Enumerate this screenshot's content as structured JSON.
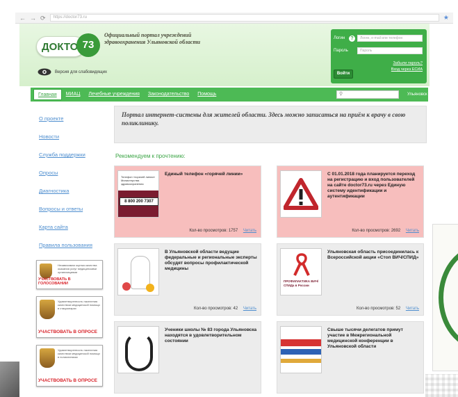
{
  "browser": {
    "back": "←",
    "forward": "→",
    "reload": "⟳",
    "address": "https://doctor73.ru"
  },
  "header": {
    "logo_word": "ДОКТОР",
    "logo_number": "73",
    "portal_title": "Официальный портал учреждений здравоохранения Ульяновской области",
    "low_vision": "Версия для слабовидящих"
  },
  "login": {
    "login_label": "Логин",
    "login_placeholder": "Логин, e-mail или телефон",
    "password_label": "Пароль",
    "password_placeholder": "Пароль",
    "submit": "Войти",
    "forgot": "Забыли пароль?",
    "esia": "Вход через ЕСИА",
    "help": "?"
  },
  "nav": {
    "items": [
      "Главная",
      "МИАЦ",
      "Лечебные учреждения",
      "Законодательство",
      "Помощь"
    ],
    "region": "Ульяновск",
    "search_icon": "search-icon"
  },
  "sidebar": {
    "items": [
      "О проекте",
      "Новости",
      "Служба поддержки",
      "Опросы",
      "Диагностика",
      "Вопросы и ответы",
      "Карта сайта",
      "Правила пользования"
    ]
  },
  "banners": [
    {
      "small": "Независимая оценка качества оказания услуг медицинскими организациями",
      "cta": "УЧАСТВОВАТЬ В ГОЛОСОВАНИИ"
    },
    {
      "small": "Удовлетворенность населения качеством медицинской помощи в стационарах",
      "cta": "УЧАСТВОВАТЬ В ОПРОСЕ"
    },
    {
      "small": "Удовлетворенность населения качеством медицинской помощи в поликлиниках",
      "cta": "УЧАСТВОВАТЬ В ОПРОСЕ"
    }
  ],
  "notice": "Портал интернет-системы для жителей области. Здесь можно записаться на приём к врачу в свою поликлинику.",
  "recommend_title": "Рекомендуем к прочтению:",
  "cards": [
    {
      "title": "Единый телефон «горячей линии»",
      "views_label": "Кол-во просмотров:",
      "views": "1757",
      "read": "Читать",
      "thumb_text": "Телефон «горячей линии» Министерства здравоохранения",
      "thumb_phone": "8 800 200 7307"
    },
    {
      "title": "С 01.01.2018 года планируется переход на регистрацию и вход пользователей на сайте doctor73.ru через Единую систему идентификации и аутентификации",
      "views_label": "Кол-во просмотров:",
      "views": "2692",
      "read": "Читать"
    },
    {
      "title": "В Ульяновской области ведущие федеральные и региональные эксперты обсудят вопросы профилактической медицины",
      "views_label": "Кол-во просмотров:",
      "views": "42",
      "read": "Читать"
    },
    {
      "title": "Ульяновская область присоединилась к Всероссийской акции «Стоп ВИЧ/СПИД»",
      "views_label": "Кол-во просмотров:",
      "views": "52",
      "read": "Читать",
      "thumb_text": "ПРОФИЛАКТИКА ВИЧ/СПИДа в России"
    },
    {
      "title": "Ученики школы № 83 города Ульяновска находятся в удовлетворительном состоянии",
      "views_label": "",
      "views": "",
      "read": ""
    },
    {
      "title": "Свыше тысячи делегатов примут участие в Межрегиональной медицинской конференции в Ульяновской области",
      "views_label": "",
      "views": "",
      "read": ""
    }
  ],
  "colors": {
    "brand_green": "#3fae48",
    "nav_green": "#4dba55",
    "card_pink": "#f7bebd",
    "card_gray": "#ececec",
    "link_blue": "#4e8ecf",
    "cta_red": "#d8232a"
  }
}
